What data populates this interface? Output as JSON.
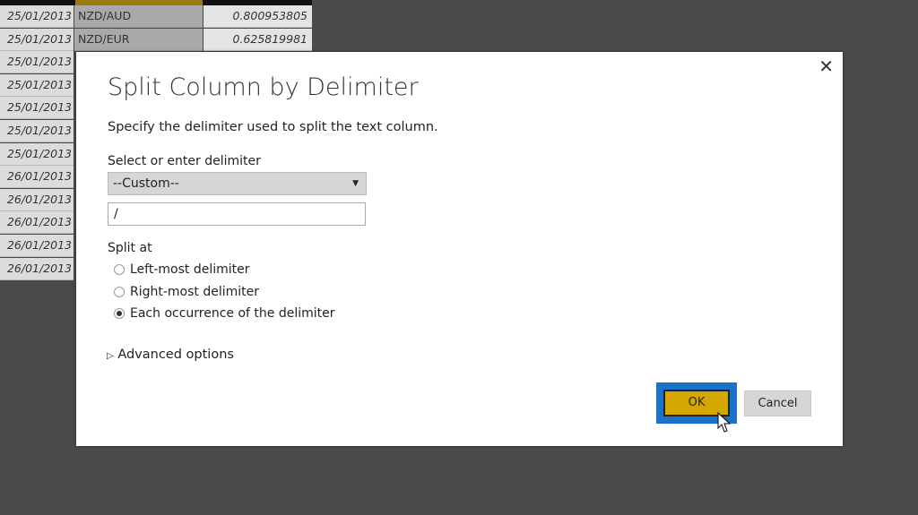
{
  "table": {
    "rows": [
      {
        "date": "25/01/2013",
        "currency": "NZD/AUD",
        "value": "0.800953805"
      },
      {
        "date": "25/01/2013",
        "currency": "NZD/EUR",
        "value": "0.625819981"
      },
      {
        "date": "25/01/2013"
      },
      {
        "date": "25/01/2013"
      },
      {
        "date": "25/01/2013"
      },
      {
        "date": "25/01/2013"
      },
      {
        "date": "25/01/2013"
      },
      {
        "date": "26/01/2013"
      },
      {
        "date": "26/01/2013"
      },
      {
        "date": "26/01/2013"
      },
      {
        "date": "26/01/2013"
      },
      {
        "date": "26/01/2013"
      }
    ]
  },
  "dialog": {
    "title": "Split Column by Delimiter",
    "description": "Specify the delimiter used to split the text column.",
    "delimiter_label": "Select or enter delimiter",
    "delimiter_selected": "--Custom--",
    "custom_value": "/",
    "split_at_label": "Split at",
    "options": [
      {
        "label": "Left-most delimiter",
        "checked": false
      },
      {
        "label": "Right-most delimiter",
        "checked": false
      },
      {
        "label": "Each occurrence of the delimiter",
        "checked": true
      }
    ],
    "advanced": "Advanced options",
    "ok": "OK",
    "cancel": "Cancel",
    "close_icon": "close-icon"
  },
  "colors": {
    "accent_focus": "#1a73c8",
    "ok_button": "#d4a800"
  }
}
